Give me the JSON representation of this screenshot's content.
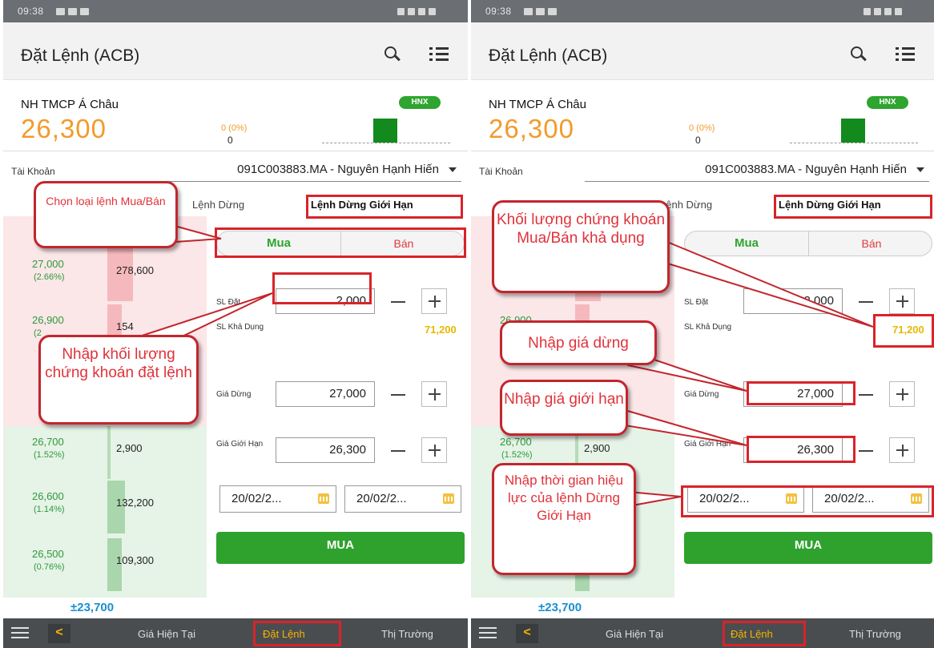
{
  "status": {
    "time": "09:38"
  },
  "app": {
    "title": "Đặt Lệnh (ACB)"
  },
  "stock": {
    "name": "NH TMCP Á Châu",
    "price": "26,300",
    "change": "0 (0%)",
    "volume": "0",
    "exchange": "HNX"
  },
  "account": {
    "label": "Tài Khoản",
    "value": "091C003883.MA - Nguyên Hạnh Hiến"
  },
  "tabs": [
    {
      "label": "Lệnh Dừng"
    },
    {
      "label": "Lệnh Dừng Giới Hạn"
    }
  ],
  "orderbook": {
    "rows": [
      {
        "price": "27,000",
        "pct": "(2.66%)",
        "qty": "278,600"
      },
      {
        "price": "26,900",
        "pct": "(2",
        "qty": "154"
      },
      {
        "price": "26,700",
        "pct": "(1.52%)",
        "qty": "2,900"
      },
      {
        "price": "26,600",
        "pct": "(1.14%)",
        "qty": "132,200"
      },
      {
        "price": "26,500",
        "pct": "(0.76%)",
        "qty": "109,300"
      }
    ],
    "total": "±23,700"
  },
  "form": {
    "buy_label": "Mua",
    "sell_label": "Bán",
    "qty_label": "SL Đặt",
    "qty_value": "2,000",
    "avail_label": "SL Khả Dụng",
    "avail_value": "71,200",
    "stop_label": "Giá Dừng",
    "stop_value": "27,000",
    "limit_label": "Giá Giới Hạn",
    "limit_value": "26,300",
    "date_from": "20/02/2...",
    "date_to": "20/02/2...",
    "submit_label": "MUA"
  },
  "bottom_nav": [
    {
      "label": "Giá Hiện Tại"
    },
    {
      "label": "Đặt Lệnh"
    },
    {
      "label": "Thị Trường"
    }
  ],
  "annotations_left": {
    "order_type": "Chọn loại lệnh Mua/Bán",
    "enter_qty": "Nhập khối lượng chứng khoán đặt lệnh"
  },
  "annotations_right": {
    "available_qty": "Khối lượng chứng khoán Mua/Bán khả dụng",
    "stop_price": "Nhập giá dừng",
    "limit_price": "Nhập giá giới hạn",
    "validity": "Nhập thời gian hiệu lực của lệnh Dừng Giới Hạn"
  },
  "colors": {
    "accent_orange": "#f39a2b",
    "buy_green": "#2ea52e",
    "sell_red": "#e0393e",
    "annotation_red": "#d9232a"
  }
}
